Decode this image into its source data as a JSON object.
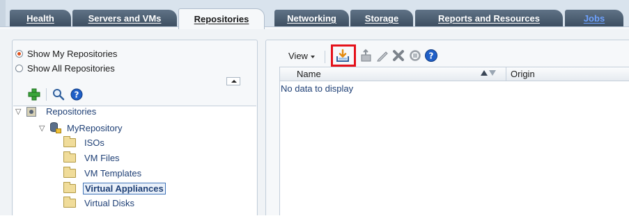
{
  "tabs": [
    {
      "label": "Health",
      "active": false
    },
    {
      "label": "Servers and VMs",
      "active": false
    },
    {
      "label": "Repositories",
      "active": true
    },
    {
      "label": "Networking",
      "active": false
    },
    {
      "label": "Storage",
      "active": false
    },
    {
      "label": "Reports and Resources",
      "active": false
    },
    {
      "label": "Jobs",
      "active": false
    }
  ],
  "left_panel": {
    "radio_options": [
      {
        "label": "Show My Repositories",
        "selected": true
      },
      {
        "label": "Show All Repositories",
        "selected": false
      }
    ],
    "toolbar_icons": [
      "add-icon",
      "search-icon",
      "help-icon"
    ],
    "tree": {
      "root": "Repositories",
      "repository": "MyRepository",
      "folders": [
        "ISOs",
        "VM Files",
        "VM Templates",
        "Virtual Appliances",
        "Virtual Disks"
      ],
      "selected_folder": "Virtual Appliances"
    }
  },
  "right_panel": {
    "view_menu_label": "View",
    "toolbar_icons": [
      "import-icon",
      "upload-icon",
      "edit-icon",
      "delete-icon",
      "refresh-icon",
      "help-icon"
    ],
    "highlighted_icon": "import-icon",
    "table": {
      "columns": [
        "Name",
        "Origin"
      ],
      "empty_message": "No data to display"
    }
  },
  "colors": {
    "tab_dark": "#4a5b6e",
    "highlight_box": "#e5111a",
    "link_text": "#1e3f75",
    "radio_selected": "#e0501a"
  }
}
